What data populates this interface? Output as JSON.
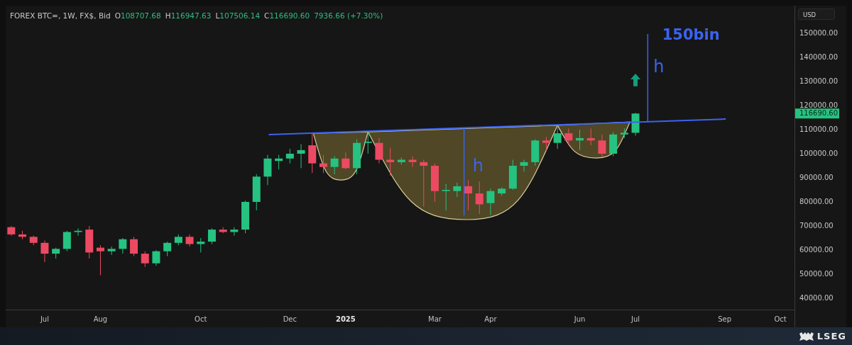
{
  "header": {
    "symbol": "FOREX BTC=, 1W, FX$, Bid",
    "ohlc": [
      {
        "label": "O",
        "value": "108707.68"
      },
      {
        "label": "H",
        "value": "116947.63"
      },
      {
        "label": "L",
        "value": "107506.14"
      },
      {
        "label": "C",
        "value": "116690.60"
      }
    ],
    "change": "7936.66 (+7.30%)"
  },
  "currency": "USD",
  "last_price": "116690.60",
  "price_labels": [
    "150000.00",
    "140000.00",
    "130000.00",
    "120000.00",
    "110000.00",
    "100000.00",
    "90000.00",
    "80000.00",
    "70000.00",
    "60000.00",
    "50000.00",
    "40000.00"
  ],
  "date_labels": [
    {
      "text": "Jul",
      "bold": false
    },
    {
      "text": "Aug",
      "bold": false
    },
    {
      "text": "Oct",
      "bold": false
    },
    {
      "text": "Dec",
      "bold": false
    },
    {
      "text": "2025",
      "bold": true
    },
    {
      "text": "Mar",
      "bold": false
    },
    {
      "text": "Apr",
      "bold": false
    },
    {
      "text": "Jun",
      "bold": false
    },
    {
      "text": "Jul",
      "bold": false
    },
    {
      "text": "Sep",
      "bold": false
    },
    {
      "text": "Oct",
      "bold": false
    }
  ],
  "annotations": [
    "h",
    "h",
    "150bin"
  ],
  "footer": {
    "brand": "LSEG"
  }
}
